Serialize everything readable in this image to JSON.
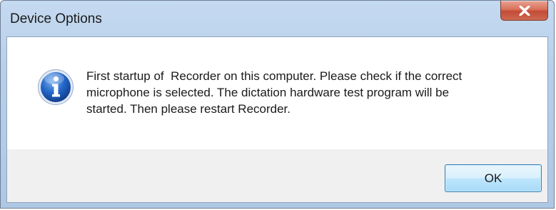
{
  "window": {
    "title": "Device Options",
    "close_icon": "close-x-icon"
  },
  "message": {
    "icon": "info-icon",
    "text": "First startup of  Recorder on this computer. Please check if the correct\nmicrophone is selected. The dictation hardware test program will be\nstarted. Then please restart Recorder."
  },
  "buttons": {
    "ok_label": "OK"
  },
  "colors": {
    "titlebar": "#b9d1ea",
    "close_button": "#c75540",
    "ok_button_border": "#3c7fb1",
    "info_icon_blue": "#1f5fbf"
  }
}
